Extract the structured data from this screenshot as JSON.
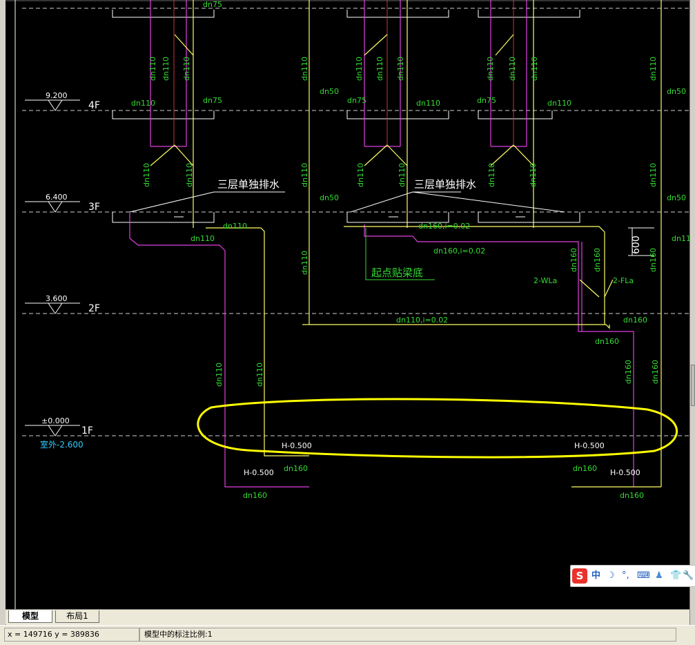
{
  "levels": [
    {
      "elev": "9.200",
      "floor": "4F"
    },
    {
      "elev": "6.400",
      "floor": "3F"
    },
    {
      "elev": "3.600",
      "floor": "2F"
    },
    {
      "elev": "±0.000",
      "floor": "1F"
    }
  ],
  "outdoor_elev": "室外-2.600",
  "notes": {
    "separate_drain": "三层单独排水",
    "beam_start": "起点贴梁底"
  },
  "pipes": {
    "dn110": "dn110",
    "dn75": "dn75",
    "dn50": "dn50",
    "dn160": "dn160",
    "slope_160": "dn160,i=0.02",
    "slope_110": "dn110,i=0.02",
    "wl": "2-WLa",
    "fl": "2-FLa",
    "dim_600": "600",
    "h_minus": "H-0.500"
  },
  "tabs": {
    "model": "模型",
    "layout1": "布局1"
  },
  "status": {
    "coords": "x = 149716 y = 389836",
    "scale": "模型中的标注比例:1"
  },
  "ime": {
    "logo": "S",
    "mode": "中",
    "moon": "☽",
    "punct": "°,",
    "kbd": "⌨",
    "user": "♟",
    "shirt": "👕",
    "tools": "🔧"
  },
  "colors": {
    "magenta": "#e040e0",
    "yellow": "#ffff66",
    "green": "#33dd33",
    "red": "#cc3333",
    "white": "#ffffff",
    "cyan": "#33ccff",
    "highlight": "#ffff00"
  }
}
